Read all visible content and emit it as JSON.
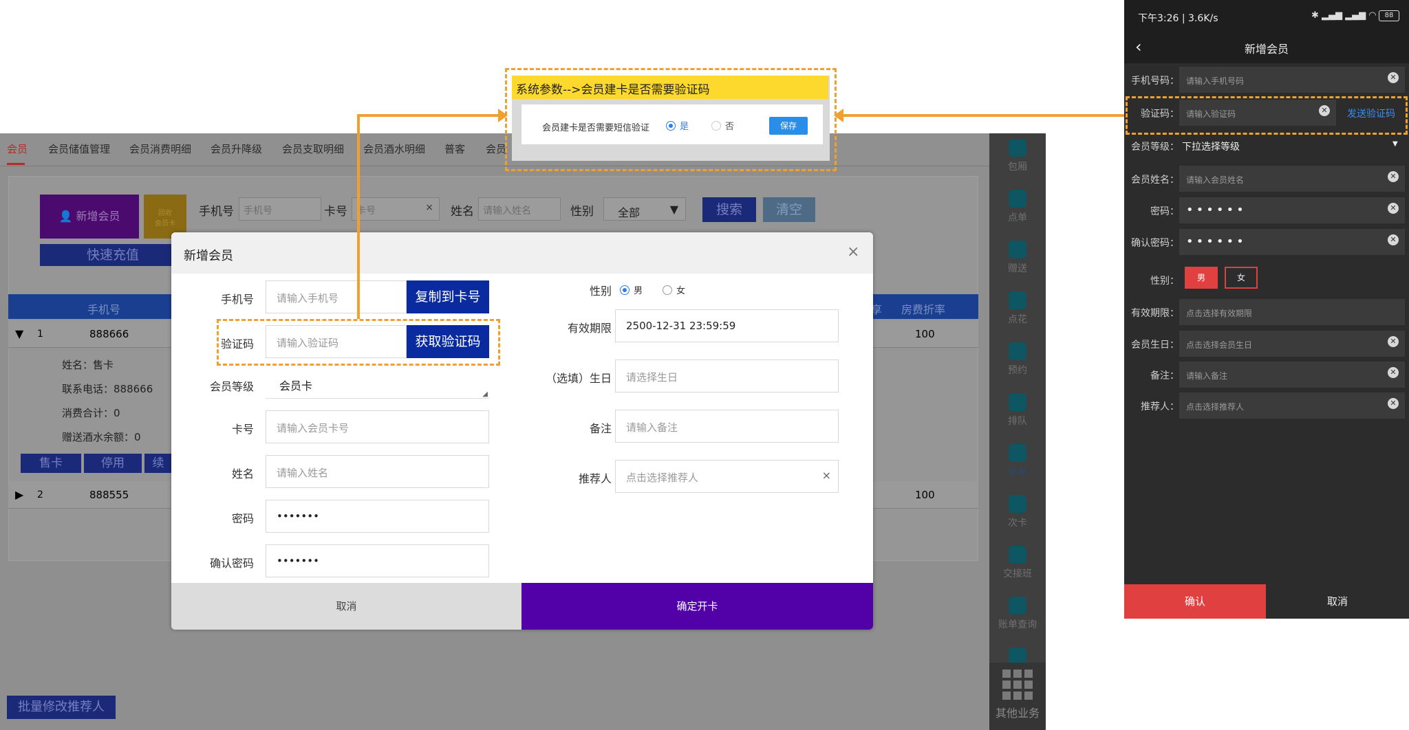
{
  "desktop": {
    "tabs": [
      "会员",
      "会员储值管理",
      "会员消费明细",
      "会员升降级",
      "会员支取明细",
      "会员酒水明细",
      "普客",
      "会员"
    ],
    "new_member_btn": "新增会员",
    "recycle_btn": "回收\n会员卡",
    "quick_recharge": "快速充值",
    "search": {
      "phone_label": "手机号",
      "phone_placeholder": "手机号",
      "card_label": "卡号",
      "card_placeholder": "卡号",
      "name_label": "姓名",
      "name_placeholder": "请输入姓名",
      "gender_label": "性别",
      "gender_value": "全部",
      "search_btn": "搜索",
      "clear_btn": "清空"
    },
    "table": {
      "col_phone": "手机号",
      "col_room_discount": "房费折率",
      "col_partial": "享",
      "rows": [
        {
          "idx": "1",
          "phone": "888666",
          "discount": "100"
        },
        {
          "idx": "2",
          "phone": "888555",
          "discount": "100"
        }
      ],
      "detail": {
        "name": "姓名：售卡",
        "tel": "联系电话：888666",
        "total": "消费合计：0",
        "gift": "赠送酒水余额：0"
      },
      "actions": [
        "售卡",
        "停用",
        "续"
      ]
    },
    "batch_btn": "批量修改推荐人",
    "side_items": [
      "包厢",
      "点单",
      "赠送",
      "点花",
      "预约",
      "排队",
      "退单",
      "次卡",
      "交接班",
      "账单查询",
      "",
      "其他业务"
    ]
  },
  "popup": {
    "title": "系统参数-->会员建卡是否需要验证码",
    "question": "会员建卡是否需要短信验证",
    "yes": "是",
    "no": "否",
    "save": "保存"
  },
  "modal": {
    "title": "新增会员",
    "close": "×",
    "phone_label": "手机号",
    "phone_placeholder": "请输入手机号",
    "copy_btn": "复制到卡号",
    "code_label": "验证码",
    "code_placeholder": "请输入验证码",
    "get_code_btn": "获取验证码",
    "level_label": "会员等级",
    "level_value": "会员卡",
    "card_label": "卡号",
    "card_placeholder": "请输入会员卡号",
    "name_label": "姓名",
    "name_placeholder": "请输入姓名",
    "pwd_label": "密码",
    "pwd_value": "•••••••",
    "pwd2_label": "确认密码",
    "pwd2_value": "•••••••",
    "gender_label": "性别",
    "male": "男",
    "female": "女",
    "expire_label": "有效期限",
    "expire_value": "2500-12-31 23:59:59",
    "birthday_label": "（选填）生日",
    "birthday_placeholder": "请选择生日",
    "remark_label": "备注",
    "remark_placeholder": "请输入备注",
    "referrer_label": "推荐人",
    "referrer_placeholder": "点击选择推荐人",
    "referrer_clear": "×",
    "cancel": "取消",
    "confirm": "确定开卡"
  },
  "mobile": {
    "status": "下午3:26 | 3.6K/s",
    "battery": "88",
    "title": "新增会员",
    "fields": [
      {
        "label": "手机号码：",
        "value": "请输入手机号码",
        "clear": true
      },
      {
        "label": "验证码：",
        "value": "请输入验证码",
        "clear": true,
        "action": "发送验证码"
      },
      {
        "label": "会员等级：",
        "value": "下拉选择等级"
      },
      {
        "label": "会员姓名：",
        "value": "请输入会员姓名",
        "clear": true
      },
      {
        "label": "密码：",
        "value": "••••••",
        "clear": true
      },
      {
        "label": "确认密码：",
        "value": "••••••",
        "clear": true
      },
      {
        "label": "性别：",
        "male": "男",
        "female": "女"
      },
      {
        "label": "有效期限：",
        "value": "点击选择有效期限"
      },
      {
        "label": "会员生日：",
        "value": "点击选择会员生日",
        "clear": true
      },
      {
        "label": "备注：",
        "value": "请输入备注",
        "clear": true
      },
      {
        "label": "推荐人：",
        "value": "点击选择推荐人",
        "clear": true
      }
    ],
    "confirm": "确认",
    "cancel": "取消"
  },
  "colors": {
    "accent_orange": "#f0a030",
    "modal_blue": "#0a2aa0",
    "confirm_purple": "#5200a8",
    "mobile_red": "#e04040"
  }
}
